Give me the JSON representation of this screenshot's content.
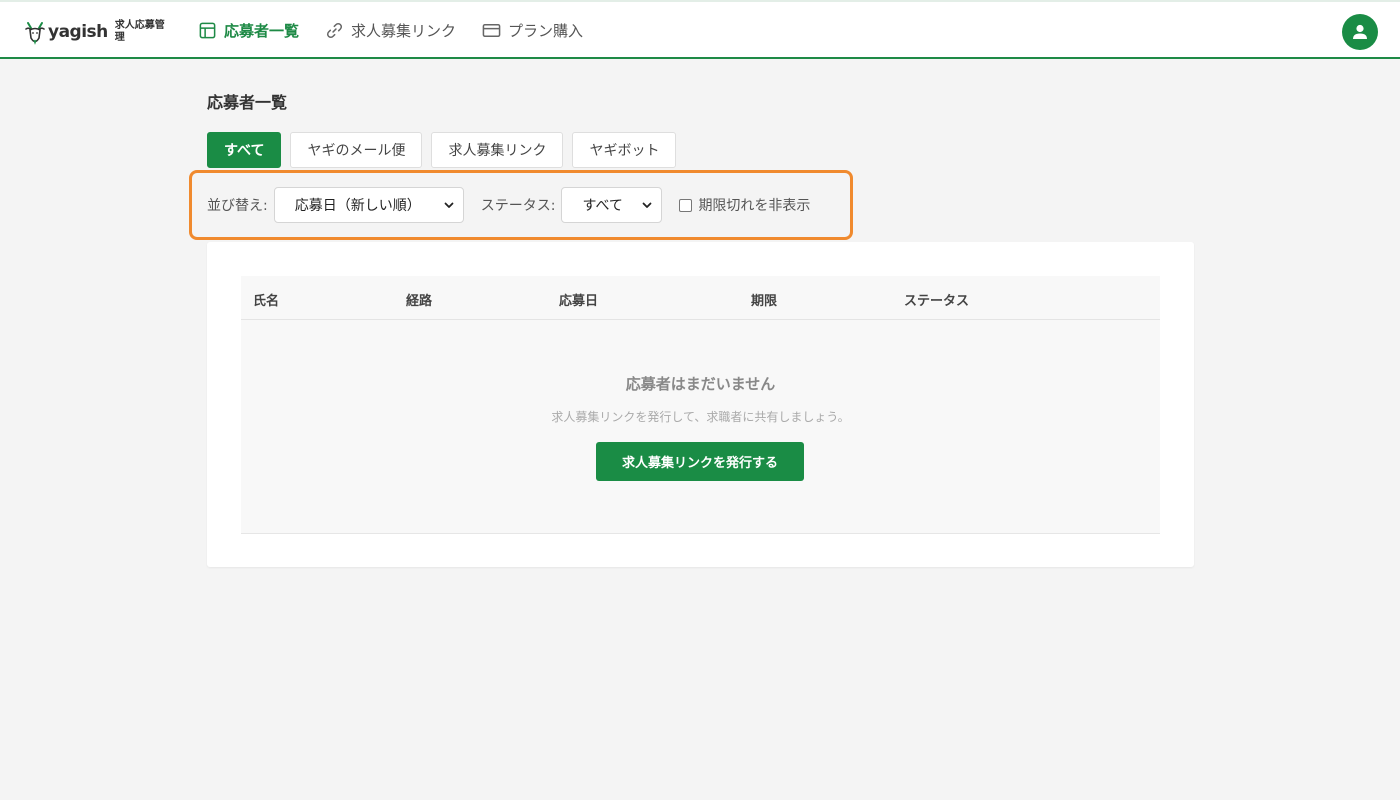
{
  "header": {
    "logo_text": "yagish",
    "logo_subtitle": "求人応募管理",
    "nav": [
      {
        "label": "応募者一覧",
        "icon": "table-icon",
        "active": true
      },
      {
        "label": "求人募集リンク",
        "icon": "link-icon",
        "active": false
      },
      {
        "label": "プラン購入",
        "icon": "credit-card-icon",
        "active": false
      }
    ],
    "user_icon": "user-icon"
  },
  "page": {
    "title": "応募者一覧"
  },
  "tabs": [
    {
      "label": "すべて",
      "active": true
    },
    {
      "label": "ヤギのメール便",
      "active": false
    },
    {
      "label": "求人募集リンク",
      "active": false
    },
    {
      "label": "ヤギボット",
      "active": false
    }
  ],
  "filters": {
    "sort_label": "並び替え:",
    "sort_value": "応募日（新しい順）",
    "status_label": "ステータス:",
    "status_value": "すべて",
    "hide_expired_label": "期限切れを非表示",
    "hide_expired_checked": false
  },
  "table": {
    "columns": [
      "氏名",
      "経路",
      "応募日",
      "期限",
      "ステータス"
    ],
    "empty_title": "応募者はまだいません",
    "empty_description": "求人募集リンクを発行して、求職者に共有しましょう。",
    "empty_button": "求人募集リンクを発行する"
  },
  "colors": {
    "brand": "#1a8c45",
    "highlight": "#f08a2e",
    "background": "#f4f4f4"
  }
}
